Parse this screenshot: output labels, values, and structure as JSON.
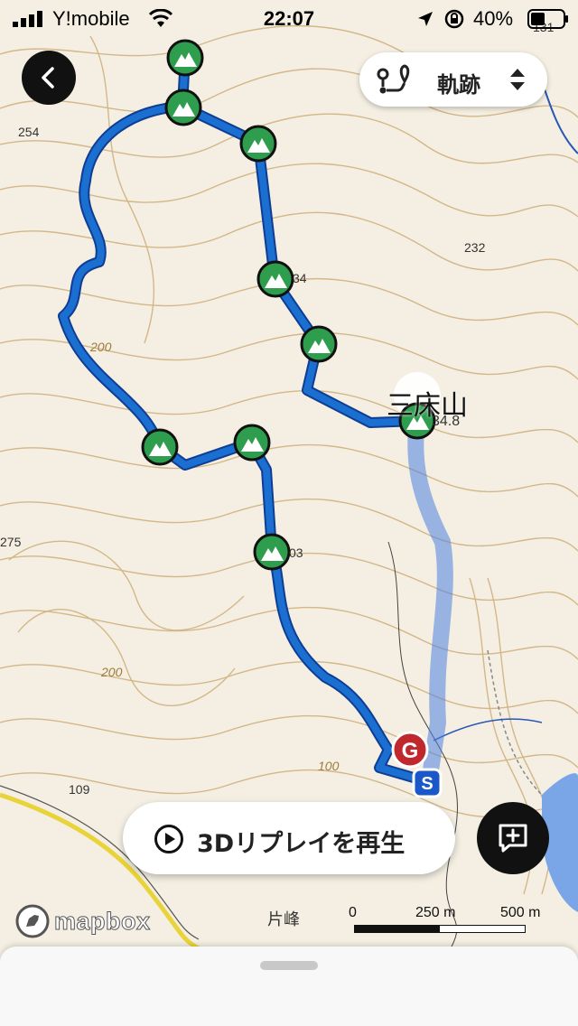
{
  "status_bar": {
    "carrier": "Y!mobile",
    "time": "22:07",
    "battery": "40%"
  },
  "header": {
    "track_selector_label": "軌跡"
  },
  "map": {
    "peak_name": "三床山",
    "peak_elevation": "34.8",
    "elevation_labels": [
      "254",
      "232",
      "275",
      "109",
      "200",
      "200",
      "100",
      "131",
      "34",
      "03"
    ],
    "start_marker": "S",
    "goal_marker": "G",
    "place_label": "片峰"
  },
  "replay_button": {
    "label": "3Dリプレイを再生"
  },
  "attribution": {
    "logo": "mapbox"
  },
  "scale_bar": {
    "labels": [
      "0",
      "250 m",
      "500 m"
    ]
  },
  "colors": {
    "track": "#1a6fd1",
    "waypoint": "#2e9e4e",
    "goal": "#c0282e",
    "start": "#1a58c9"
  }
}
